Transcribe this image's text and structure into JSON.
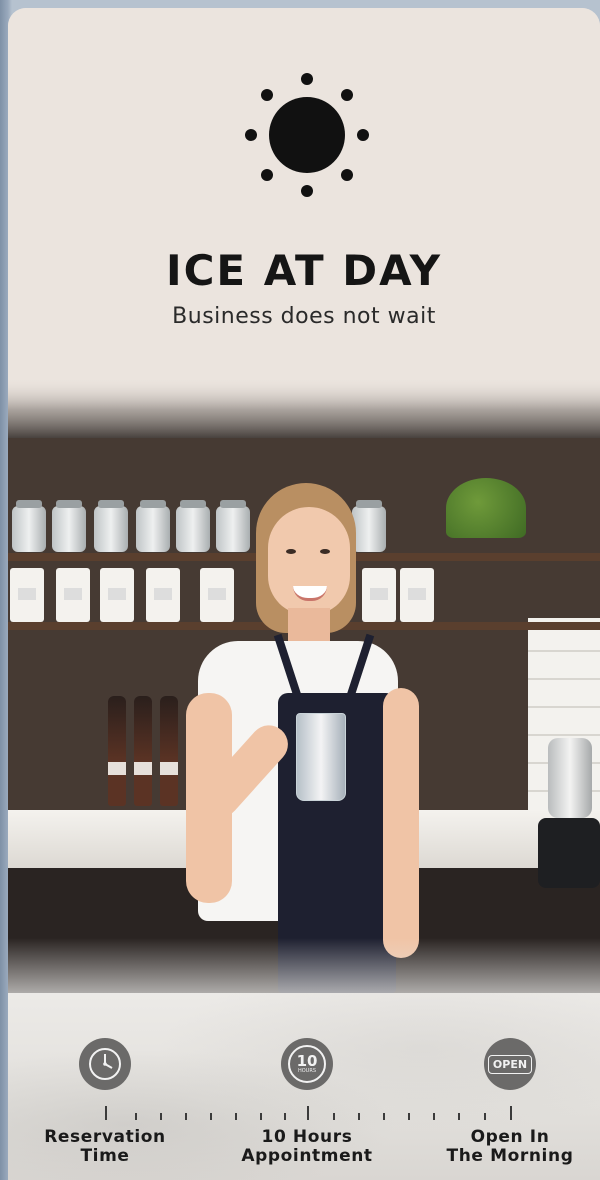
{
  "header": {
    "icon": "sun-icon",
    "title": "ICE AT DAY",
    "subtitle": "Business does not wait"
  },
  "photo": {
    "description_icon": "barista-photo"
  },
  "features": [
    {
      "icon": "clock-icon",
      "label_line1": "Reservation",
      "label_line2": "Time"
    },
    {
      "icon": "ten-hours-badge-icon",
      "badge_number": "10",
      "badge_text": "HOURS",
      "label_line1": "10 Hours",
      "label_line2": "Appointment"
    },
    {
      "icon": "open-sign-icon",
      "badge_text": "OPEN",
      "label_line1": "Open In",
      "label_line2": "The Morning"
    }
  ],
  "colors": {
    "background": "#ebe4de",
    "icon_circle": "#6b6a69",
    "text": "#151515"
  }
}
